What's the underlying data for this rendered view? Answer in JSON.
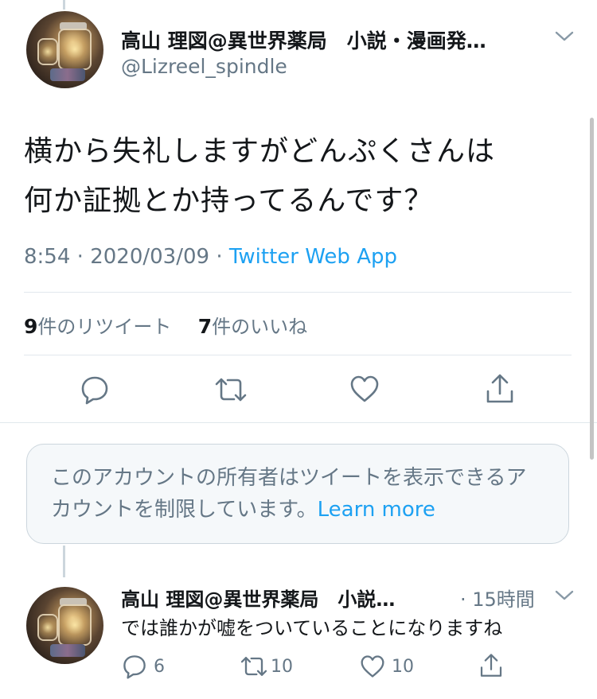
{
  "main_tweet": {
    "display_name": "高山 理図@異世界薬局　小説・漫画発…",
    "handle": "@Lizreel_spindle",
    "text_line1": "横から失礼しますがどんぷくさんは",
    "text_line2": "何か証拠とか持ってるんです？",
    "time": "8:54",
    "date": "2020/03/09",
    "separator": "·",
    "source": "Twitter Web App",
    "retweet_count": "9",
    "retweet_label": "件のリツイート",
    "like_count": "7",
    "like_label": "件のいいね"
  },
  "notice": {
    "text": "このアカウントの所有者はツイートを表示できるアカウントを制限しています。",
    "link": "Learn more"
  },
  "reply_tweet": {
    "display_name": "高山 理図@異世界薬局　小説…",
    "time": "· 15時間",
    "text": "では誰かが嘘をついていることになりますね",
    "reply_count": "6",
    "retweet_count": "10",
    "like_count": "10"
  },
  "colors": {
    "accent": "#1da1f2",
    "secondary_text": "#657786",
    "icon": "#657786",
    "divider": "#e1e8ed"
  },
  "icons": [
    "reply-icon",
    "retweet-icon",
    "like-icon",
    "share-icon",
    "chevron-down-icon"
  ]
}
